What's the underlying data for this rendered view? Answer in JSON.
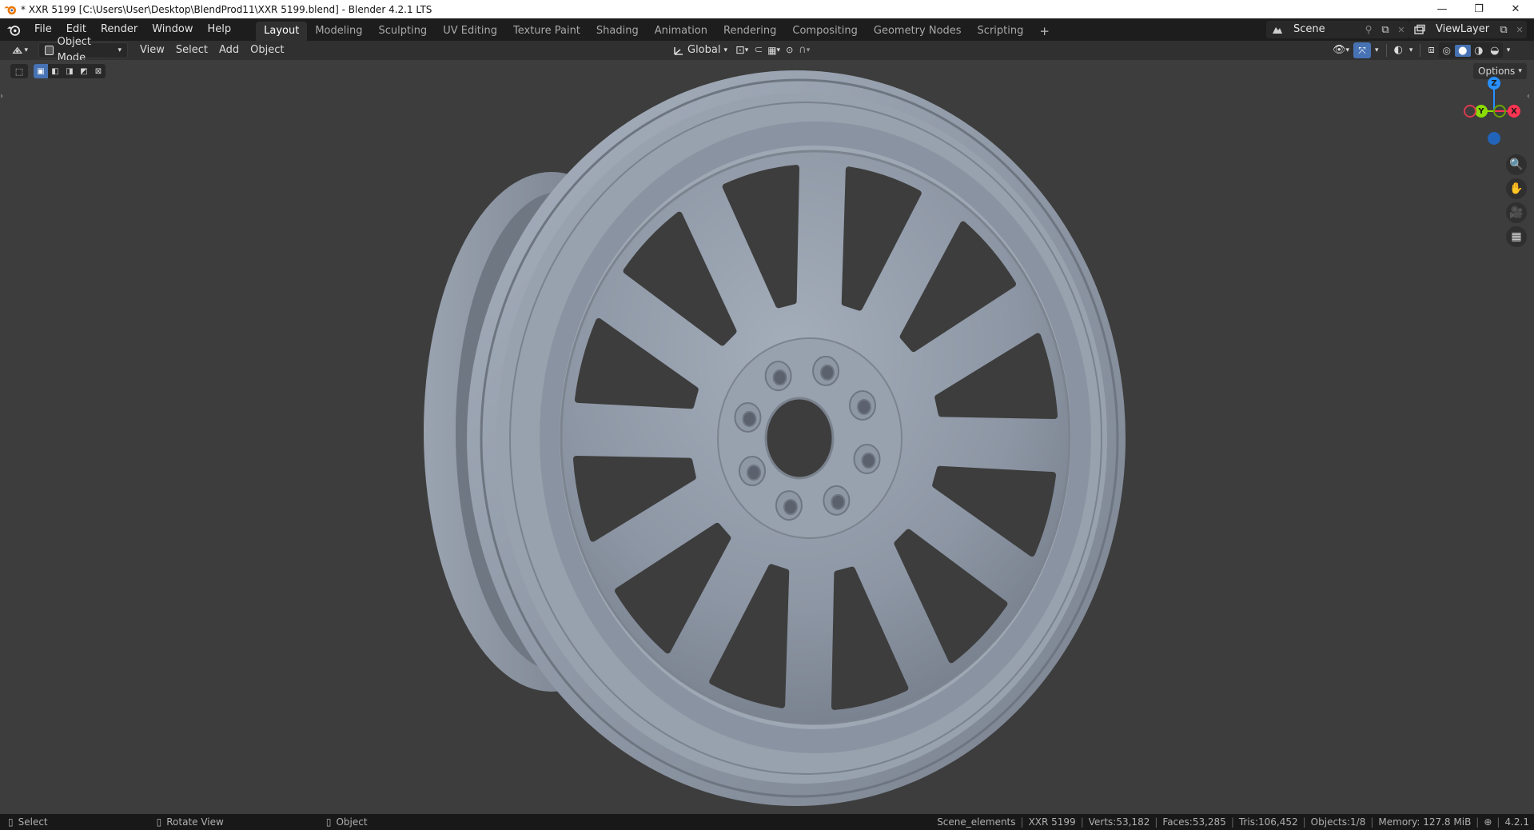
{
  "window": {
    "title": "* XXR 5199 [C:\\Users\\User\\Desktop\\BlendProd11\\XXR 5199.blend] - Blender 4.2.1 LTS",
    "controls": {
      "minimize": "—",
      "restore": "❐",
      "close": "✕"
    }
  },
  "topbar": {
    "menus": [
      "File",
      "Edit",
      "Render",
      "Window",
      "Help"
    ],
    "workspaces": [
      "Layout",
      "Modeling",
      "Sculpting",
      "UV Editing",
      "Texture Paint",
      "Shading",
      "Animation",
      "Rendering",
      "Compositing",
      "Geometry Nodes",
      "Scripting"
    ],
    "active_workspace": "Layout",
    "add_tab": "+",
    "scene": "Scene",
    "view_layer": "ViewLayer"
  },
  "header": {
    "mode": "Object Mode",
    "menus": [
      "View",
      "Select",
      "Add",
      "Object"
    ],
    "transform_orientation": "Global",
    "options": "Options"
  },
  "gizmo": {
    "z": "Z",
    "y": "Y",
    "x": "X"
  },
  "status": {
    "left": [
      {
        "label": "Select"
      },
      {
        "label": "Rotate View"
      },
      {
        "label": "Object"
      }
    ],
    "collection": "Scene_elements",
    "object": "XXR 5199",
    "verts": "Verts:53,182",
    "faces": "Faces:53,285",
    "tris": "Tris:106,452",
    "objects": "Objects:1/8",
    "memory": "Memory: 127.8 MiB",
    "version": "4.2.1"
  },
  "colors": {
    "wheel": "#8c95a3",
    "viewport_bg": "#3d3d3d",
    "topbar_bg": "#1d1d1d",
    "header_bg": "#303030",
    "accent_blue": "#4772b3",
    "axis_x": "#ff3352",
    "axis_y": "#8bdc00",
    "axis_z": "#2890ff"
  }
}
